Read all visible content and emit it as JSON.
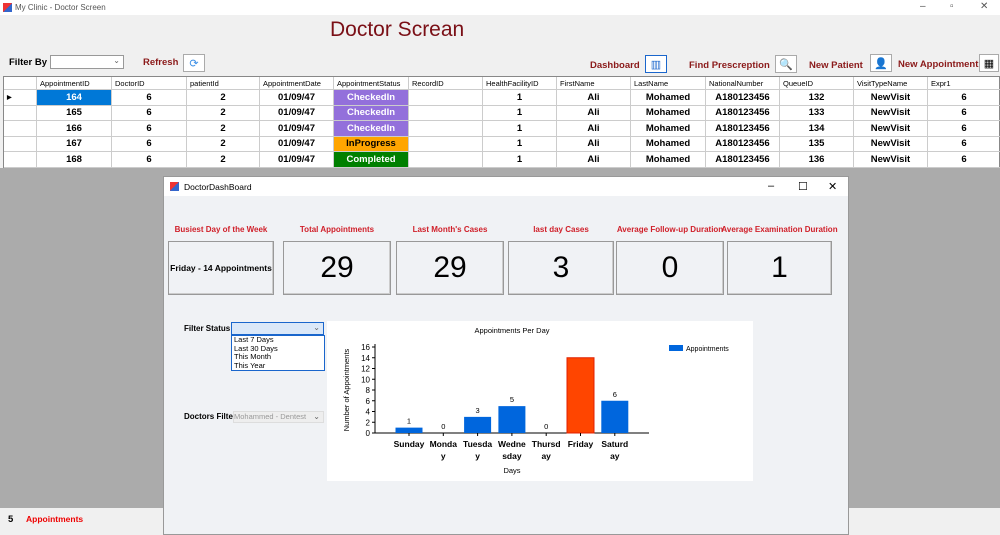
{
  "window": {
    "title": "My Clinic - Doctor Screen",
    "heading": "Doctor Screan"
  },
  "toolbar": {
    "filter_by": "Filter By",
    "filter_value": "",
    "refresh": "Refresh",
    "dashboard": "Dashboard",
    "find_prescription": "Find Prescreption",
    "new_patient": "New Patient",
    "new_appointment": "New Appointment"
  },
  "grid": {
    "columns": [
      "AppointmentID",
      "DoctorID",
      "patientId",
      "AppointmentDate",
      "AppointmentStatus",
      "RecordID",
      "HealthFacilityID",
      "FirstName",
      "LastName",
      "NationalNumber",
      "QueueID",
      "VisitTypeName",
      "Expr1"
    ],
    "rows": [
      [
        "164",
        "6",
        "2",
        "01/09/47",
        "CheckedIn",
        "",
        "1",
        "Ali",
        "Mohamed",
        "A180123456",
        "132",
        "NewVisit",
        "6"
      ],
      [
        "165",
        "6",
        "2",
        "01/09/47",
        "CheckedIn",
        "",
        "1",
        "Ali",
        "Mohamed",
        "A180123456",
        "133",
        "NewVisit",
        "6"
      ],
      [
        "166",
        "6",
        "2",
        "01/09/47",
        "CheckedIn",
        "",
        "1",
        "Ali",
        "Mohamed",
        "A180123456",
        "134",
        "NewVisit",
        "6"
      ],
      [
        "167",
        "6",
        "2",
        "01/09/47",
        "InProgress",
        "",
        "1",
        "Ali",
        "Mohamed",
        "A180123456",
        "135",
        "NewVisit",
        "6"
      ],
      [
        "168",
        "6",
        "2",
        "01/09/47",
        "Completed",
        "",
        "1",
        "Ali",
        "Mohamed",
        "A180123456",
        "136",
        "NewVisit",
        "6"
      ]
    ],
    "status_colors": {
      "CheckedIn": "#9370db",
      "InProgress": "#ffa500",
      "Completed": "#008000"
    }
  },
  "statusbar": {
    "count": "5",
    "label": "Appointments"
  },
  "dashboard": {
    "title": "DoctorDashBoard",
    "cards": [
      {
        "label": "Busiest Day of the Week",
        "value": "Friday - 14 Appointments"
      },
      {
        "label": "Total Appointments",
        "value": "29"
      },
      {
        "label": "Last Month's Cases",
        "value": "29"
      },
      {
        "label": "last day Cases",
        "value": "3"
      },
      {
        "label": "Average Follow-up Duration",
        "value": "0"
      },
      {
        "label": "Average Examination Duration",
        "value": "1"
      }
    ],
    "filter_status_label": "Filter Status",
    "filter_status_value": "",
    "filter_status_options": [
      "Last 7 Days",
      "Last 30 Days",
      "This Month",
      "This Year"
    ],
    "doctors_filter_label": "Doctors Filter",
    "doctors_filter_value": "Mohammed - Dentest"
  },
  "chart_data": {
    "type": "bar",
    "title": "Appointments Per Day",
    "xlabel": "Days",
    "ylabel": "Number of Appointments",
    "categories": [
      "Sunday",
      "Monday",
      "Tuesday",
      "Wednesday",
      "Thursday",
      "Friday",
      "Saturday"
    ],
    "category_lines": [
      [
        "Sunday",
        ""
      ],
      [
        "Monda",
        "y"
      ],
      [
        "Tuesda",
        "y"
      ],
      [
        "Wedne",
        "sday"
      ],
      [
        "Thursd",
        "ay"
      ],
      [
        "Friday",
        ""
      ],
      [
        "Saturd",
        "ay"
      ]
    ],
    "values": [
      1,
      0,
      3,
      5,
      0,
      14,
      6
    ],
    "ylim": [
      0,
      16
    ],
    "yticks": [
      0,
      2,
      4,
      6,
      8,
      10,
      12,
      14,
      16
    ],
    "legend": "Appointments",
    "legend_position": "top-right",
    "colors": {
      "default": "#0066dd",
      "highlight": "#ff4500"
    }
  }
}
